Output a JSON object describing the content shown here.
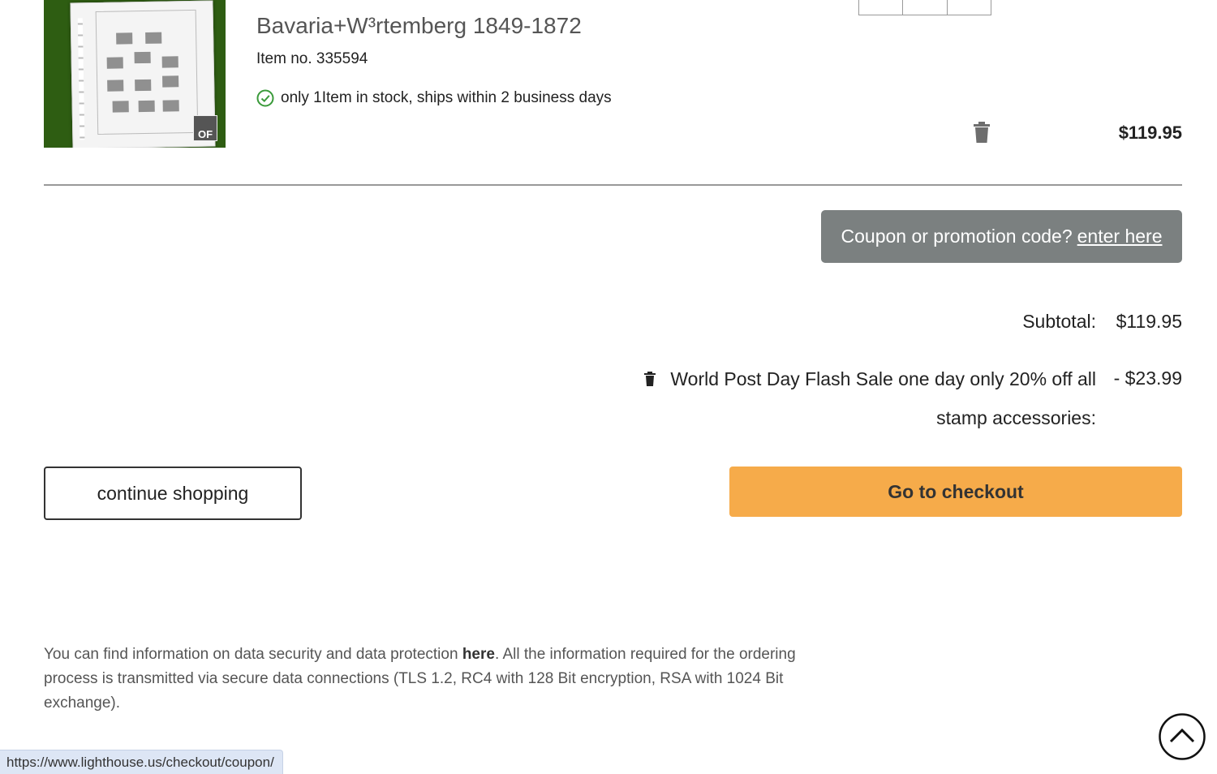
{
  "product": {
    "title": "Bavaria+W³rtemberg 1849-1872",
    "item_no": "Item no. 335594",
    "stock": "only 1Item in stock, ships within 2 business days",
    "price": "$119.95",
    "thumb_badge": "OF"
  },
  "coupon": {
    "prompt": "Coupon or promotion code?",
    "link": "enter here"
  },
  "totals": {
    "subtotal_label": "Subtotal:",
    "subtotal_value": "$119.95",
    "discount_label": "World Post Day Flash Sale one day only 20% off all stamp accessories:",
    "discount_value": "- $23.99"
  },
  "actions": {
    "continue": "continue shopping",
    "checkout": "Go to checkout"
  },
  "info": {
    "before": "You can find information on data security and data protection ",
    "link": "here",
    "after": ". All the information required for the ordering process is transmitted via secure data connections (TLS 1.2, RC4 with 128 Bit encryption, RSA with 1024 Bit exchange)."
  },
  "status_url": "https://www.lighthouse.us/checkout/coupon/",
  "colors": {
    "checkout": "#f6ab4a",
    "coupon_bg": "#7b8080",
    "stock_check": "#3a9a3a"
  }
}
